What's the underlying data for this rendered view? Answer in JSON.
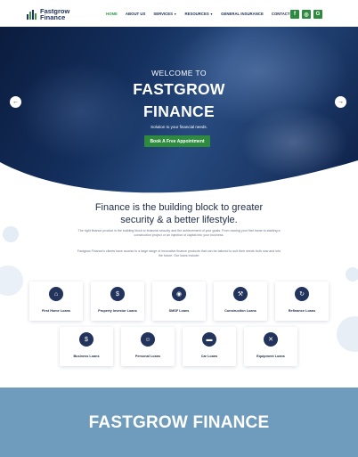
{
  "brand": {
    "line1": "Fastgrow",
    "line2": "Finance"
  },
  "nav": [
    {
      "label": "HOME",
      "active": true
    },
    {
      "label": "ABOUT US"
    },
    {
      "label": "SERVICES",
      "dropdown": true
    },
    {
      "label": "RESOURCES",
      "dropdown": true
    },
    {
      "label": "GENERAL INSURANCE"
    },
    {
      "label": "CONTACT US"
    }
  ],
  "social": [
    {
      "icon": "facebook-icon",
      "glyph": "f"
    },
    {
      "icon": "instagram-icon",
      "glyph": "◎"
    },
    {
      "icon": "google-icon",
      "glyph": "G"
    }
  ],
  "hero": {
    "welcome": "WELCOME TO",
    "title_line1": "FASTGROW",
    "title_line2": "FINANCE",
    "tagline": "Solution to your financial needs.",
    "cta": "Book A Free Appointment",
    "prev_arrow": "←",
    "next_arrow": "→"
  },
  "intro": {
    "headline_line1": "Finance is the building block to greater",
    "headline_line2": "security & a better lifestyle.",
    "paragraph1": "The right finance product is the building block to financial security and the achievement of your goals. From owning your first home to starting a construction project or an injection of capital into your business.",
    "paragraph2": "Fastgrow Finance's clients have access to a large range of innovative finance products that can be tailored to suit their needs both now and into the future. Our loans include:"
  },
  "loans_row1": [
    {
      "label": "First Home Loans",
      "icon": "house-icon",
      "glyph": "⌂"
    },
    {
      "label": "Property Investor Loans",
      "icon": "property-investment-icon",
      "glyph": "$"
    },
    {
      "label": "SMSF Loans",
      "icon": "smsf-icon",
      "glyph": "◉"
    },
    {
      "label": "Construction Loans",
      "icon": "construction-icon",
      "glyph": "⚒"
    },
    {
      "label": "Refinance Loans",
      "icon": "refinance-icon",
      "glyph": "↻"
    }
  ],
  "loans_row2": [
    {
      "label": "Business Loans",
      "icon": "business-icon",
      "glyph": "$"
    },
    {
      "label": "Personal Loans",
      "icon": "personal-icon",
      "glyph": "☺"
    },
    {
      "label": "Car Loans",
      "icon": "car-icon",
      "glyph": "▬"
    },
    {
      "label": "Equipment Loans",
      "icon": "equipment-icon",
      "glyph": "✕"
    }
  ],
  "banner": {
    "title": "FASTGROW FINANCE"
  },
  "colors": {
    "navy": "#22335c",
    "green": "#2e8a3e",
    "banner": "#6f9cbc"
  }
}
